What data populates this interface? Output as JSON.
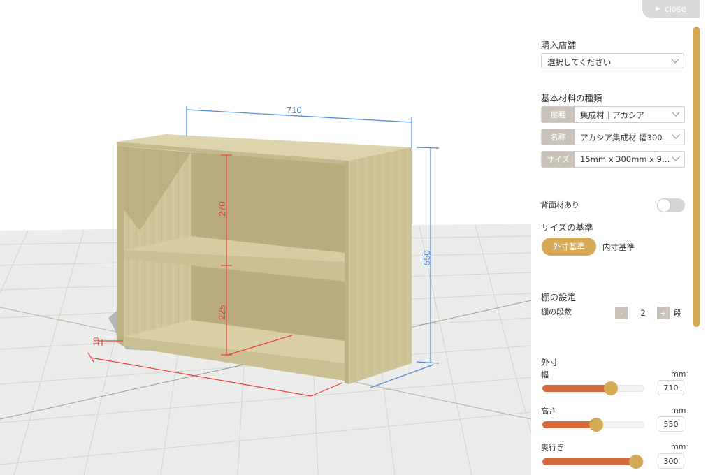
{
  "header": {
    "close_label": "close"
  },
  "dimensions": {
    "width": "710",
    "height": "550",
    "top_space": "270",
    "bottom_space": "225",
    "thickness": "10"
  },
  "panel": {
    "store": {
      "title": "購入店舗",
      "placeholder": "選択してください"
    },
    "material": {
      "title": "基本材料の種類",
      "rows": [
        {
          "tag": "樹種",
          "value": "集成材｜アカシア"
        },
        {
          "tag": "名称",
          "value": "アカシア集成材 幅300"
        },
        {
          "tag": "サイズ",
          "value": "15mm x 300mm x 9…"
        }
      ]
    },
    "back_panel": {
      "label": "背面材あり",
      "enabled": false
    },
    "size_basis": {
      "title": "サイズの基準",
      "active": "外寸基準",
      "inactive": "内寸基準"
    },
    "shelf": {
      "title": "棚の設定",
      "count_label": "棚の段数",
      "minus": "-",
      "plus": "+",
      "value": "2",
      "unit": "段"
    },
    "outer": {
      "title": "外寸",
      "sliders": [
        {
          "label": "幅",
          "unit": "mm",
          "value": "710",
          "fraction": 0.67
        },
        {
          "label": "高さ",
          "unit": "mm",
          "value": "550",
          "fraction": 0.53
        },
        {
          "label": "奥行き",
          "unit": "mm",
          "value": "300",
          "fraction": 0.92
        }
      ]
    }
  },
  "colors": {
    "accent": "#d4aa57",
    "slider": "#d4693b",
    "dim_blue": "#4a8bd9",
    "dim_red": "#e8403a"
  }
}
